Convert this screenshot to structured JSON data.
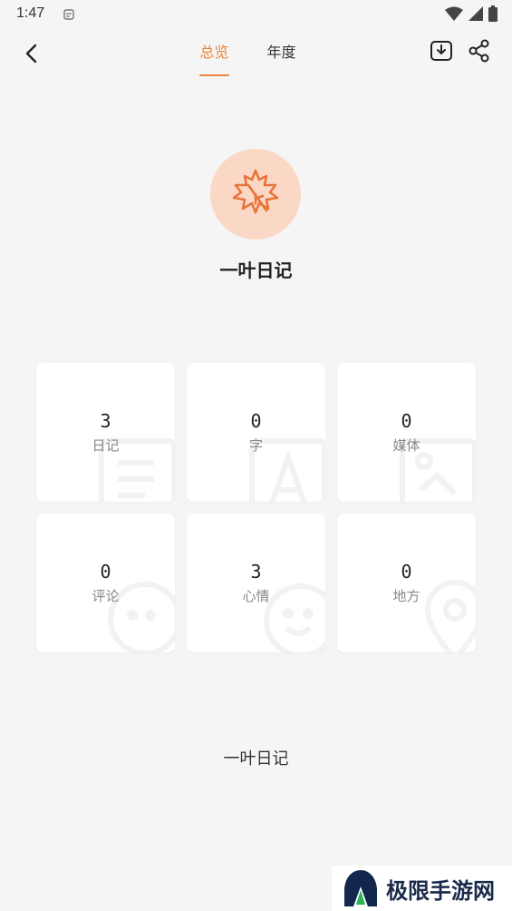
{
  "status_bar": {
    "time": "1:47",
    "icons": [
      "notification-icon",
      "wifi-icon",
      "signal-icon",
      "battery-icon"
    ]
  },
  "header": {
    "tabs": [
      {
        "label": "总览",
        "active": true
      },
      {
        "label": "年度",
        "active": false
      }
    ],
    "icons": [
      "back-arrow-icon",
      "download-icon",
      "share-icon"
    ]
  },
  "profile": {
    "icon": "maple-leaf-icon",
    "title": "一叶日记"
  },
  "stats": [
    {
      "value": "3",
      "label": "日记",
      "bg_icon": "document-icon"
    },
    {
      "value": "0",
      "label": "字",
      "bg_icon": "text-icon"
    },
    {
      "value": "0",
      "label": "媒体",
      "bg_icon": "image-icon"
    },
    {
      "value": "0",
      "label": "评论",
      "bg_icon": "comment-icon"
    },
    {
      "value": "3",
      "label": "心情",
      "bg_icon": "smile-icon"
    },
    {
      "value": "0",
      "label": "地方",
      "bg_icon": "location-icon"
    }
  ],
  "footer": {
    "title": "一叶日记"
  },
  "watermark": {
    "text": "极限手游网"
  },
  "colors": {
    "accent": "#e8853f",
    "avatar_bg": "#fbd8c6",
    "background": "#f5f5f5"
  }
}
